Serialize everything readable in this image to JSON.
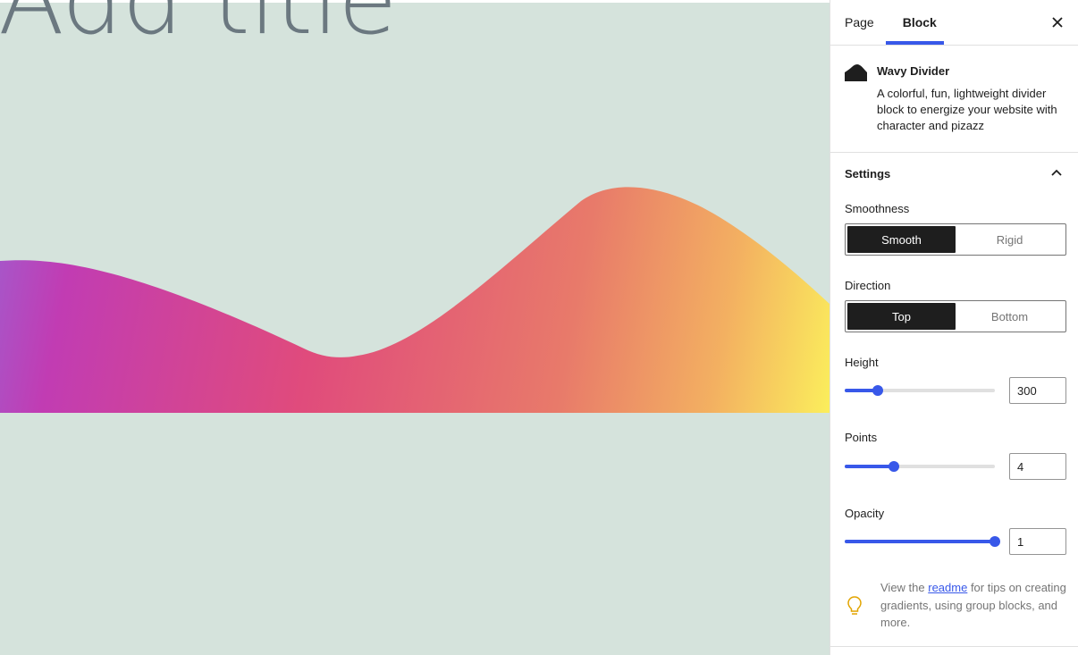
{
  "canvas": {
    "post_title_placeholder": "Add title",
    "background_color": "#d5e3dc",
    "title_color": "#6b7880",
    "divider_gradient": [
      "#a855c8",
      "#c13cb3",
      "#e04b7c",
      "#e87a6a",
      "#f3b061",
      "#fbee5c"
    ]
  },
  "sidebar": {
    "tabs": [
      {
        "label": "Page",
        "active": false
      },
      {
        "label": "Block",
        "active": true
      }
    ],
    "close_icon": "close-icon",
    "block": {
      "icon": "wavy-divider-icon",
      "title": "Wavy Divider",
      "description": "A colorful, fun, lightweight divider block to energize your website with character and pizazz"
    },
    "settings": {
      "heading": "Settings",
      "toggle_icon": "chevron-up-icon",
      "smoothness": {
        "label": "Smoothness",
        "options": [
          "Smooth",
          "Rigid"
        ],
        "selected": "Smooth"
      },
      "direction": {
        "label": "Direction",
        "options": [
          "Top",
          "Bottom"
        ],
        "selected": "Top"
      },
      "height": {
        "label": "Height",
        "value": "300",
        "fraction": 0.22
      },
      "points": {
        "label": "Points",
        "value": "4",
        "fraction": 0.33
      },
      "opacity": {
        "label": "Opacity",
        "value": "1",
        "fraction": 1.0
      }
    },
    "tip": {
      "icon": "lightbulb-icon",
      "prefix": "View the ",
      "link": "readme",
      "suffix": " for tips on creating gradients, using group blocks, and more."
    },
    "accent_color": "#3858e9"
  }
}
